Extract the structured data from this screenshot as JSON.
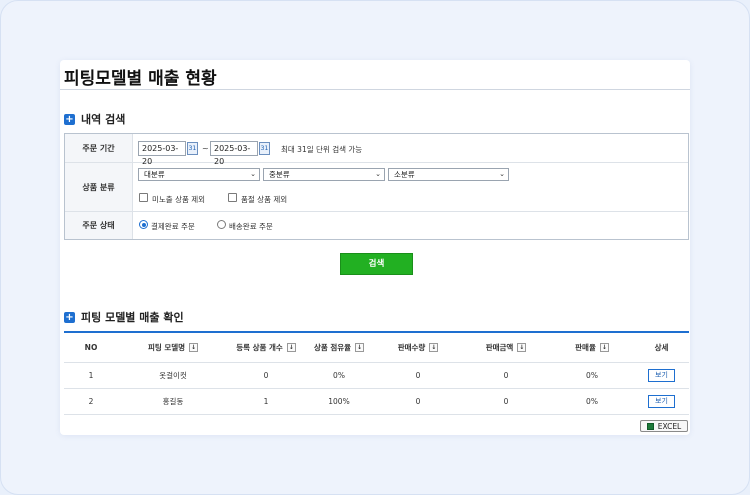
{
  "page": {
    "title": "피팅모델별 매출 현황"
  },
  "search_section": {
    "title": "내역 검색"
  },
  "search": {
    "order_period_label": "주문 기간",
    "date_from": "2025-03-20",
    "date_to": "2025-03-20",
    "calendar_glyph": "31",
    "tilde": "~",
    "period_hint": "최대 31일 단위 검색 가능",
    "category_label": "상품 분류",
    "category_large": "대분류",
    "category_medium": "중분류",
    "category_small": "소분류",
    "exclude_hidden_label": "미노출 상품 제외",
    "exclude_soldout_label": "품절 상품 제외",
    "order_status_label": "주문 상태",
    "status_paid_label": "결제완료 주문",
    "status_shipped_label": "배송완료 주문",
    "selected_status": "결제완료 주문",
    "search_button": "검색"
  },
  "result_section": {
    "title": "피팅 모델별 매출 확인"
  },
  "table": {
    "columns": [
      "NO",
      "피팅 모델명",
      "등록 상품 개수",
      "상품 점유율",
      "판매수량",
      "판매금액",
      "판매율",
      "상세"
    ],
    "sort_glyph": "↓",
    "rows": [
      {
        "no": "1",
        "model": "옷걸이컷",
        "count": "0",
        "share": "0%",
        "qty": "0",
        "amount": "0",
        "rate": "0%",
        "detail": "보기"
      },
      {
        "no": "2",
        "model": "홍길동",
        "count": "1",
        "share": "100%",
        "qty": "0",
        "amount": "0",
        "rate": "0%",
        "detail": "보기"
      }
    ]
  },
  "excel_button": "EXCEL",
  "colors": {
    "accent": "#1e6fd0",
    "search_button": "#22b022",
    "excel_icon": "#1d7a3a"
  }
}
